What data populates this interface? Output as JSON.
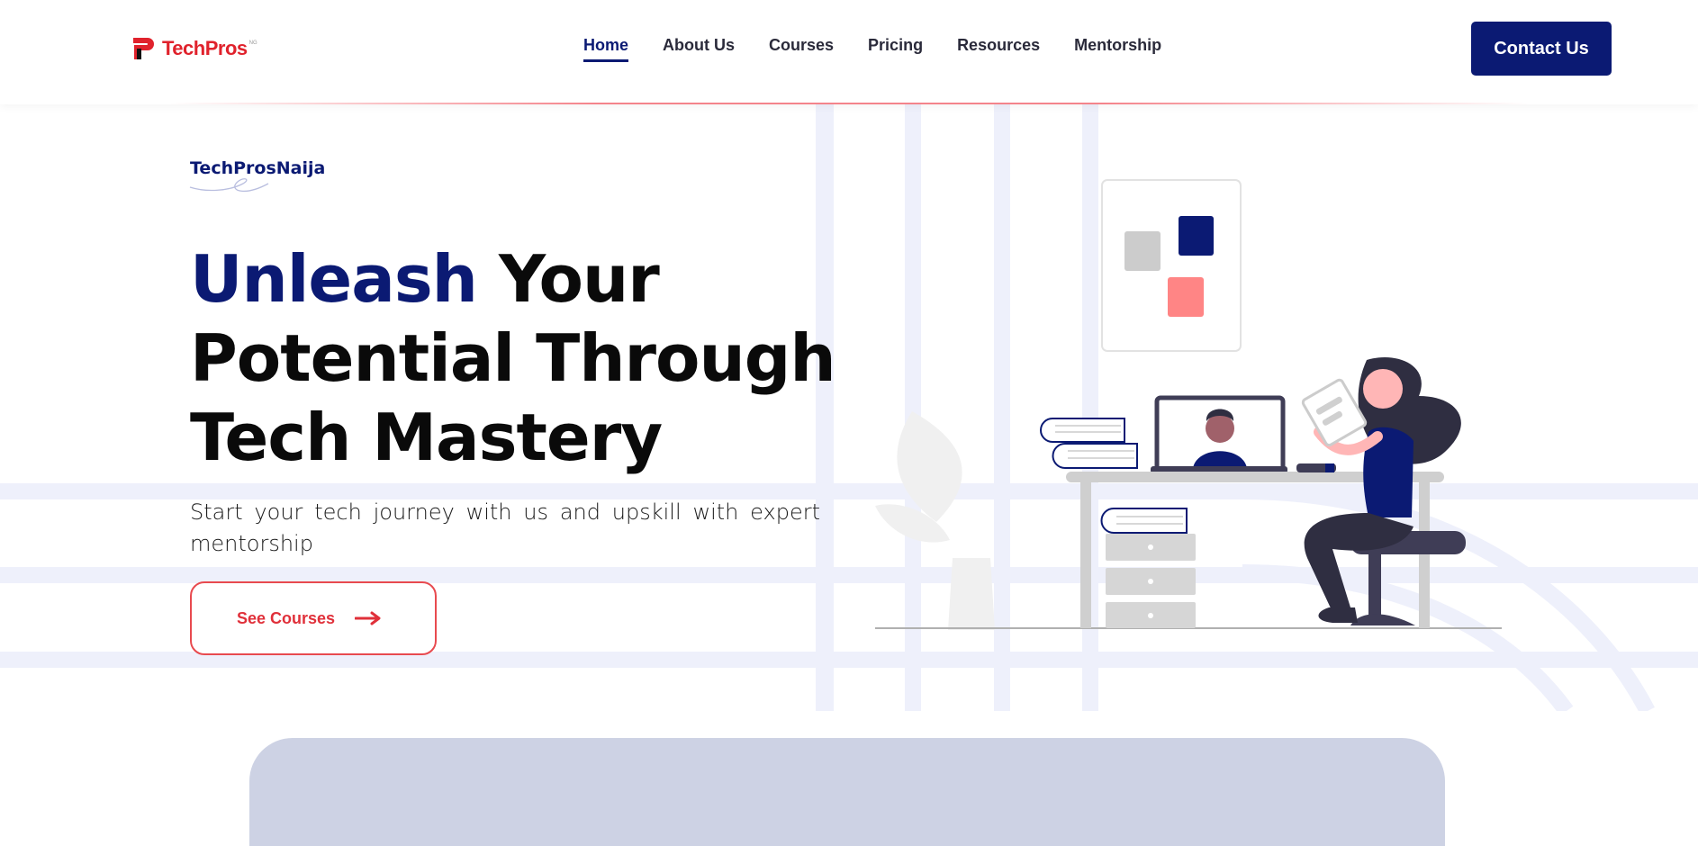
{
  "header": {
    "logo_text": "TechPros",
    "logo_sup": "NG",
    "nav": [
      {
        "label": "Home",
        "active": true
      },
      {
        "label": "About Us",
        "active": false
      },
      {
        "label": "Courses",
        "active": false
      },
      {
        "label": "Pricing",
        "active": false
      },
      {
        "label": "Resources",
        "active": false
      },
      {
        "label": "Mentorship",
        "active": false
      }
    ],
    "contact_label": "Contact Us"
  },
  "hero": {
    "eyebrow": "TechProsNaija",
    "headline_accent": "Unleash",
    "headline_line1_rest": " Your",
    "headline_line2": "Potential Through",
    "headline_line3": "Tech Mastery",
    "subtitle": "Start your tech journey with us and upskill with expert mentorship",
    "cta_label": "See Courses"
  },
  "colors": {
    "brand_navy": "#0b1a73",
    "brand_red": "#e0222c",
    "grid_lavender": "#eef0fb",
    "card_bg": "#cdd2e4",
    "accent_pink": "#ff8585"
  },
  "icons": {
    "logo": "techpros-logo-mark",
    "cta_arrow": "arrow-right-icon"
  }
}
